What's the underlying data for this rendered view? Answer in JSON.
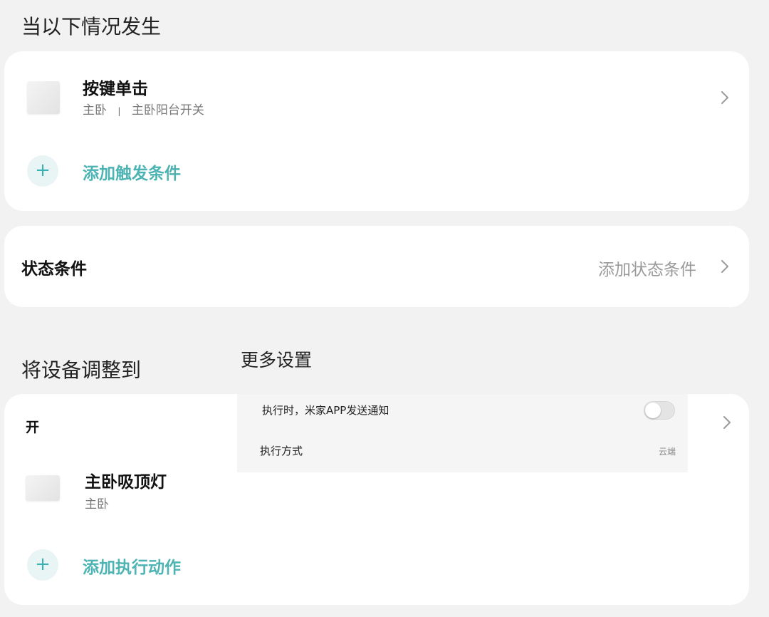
{
  "trigger_section": {
    "title": "当以下情况发生",
    "trigger": {
      "title": "按键单击",
      "room": "主卧",
      "separator": "|",
      "device": "主卧阳台开关",
      "thumb_icon": "switch-device-icon"
    },
    "add_trigger_label": "添加触发条件"
  },
  "state_section": {
    "title": "状态条件",
    "action_label": "添加状态条件"
  },
  "action_section": {
    "title": "将设备调整到",
    "state_label": "开",
    "device": {
      "name": "主卧吸顶灯",
      "room": "主卧",
      "thumb_icon": "ceiling-light-icon"
    },
    "add_action_label": "添加执行动作"
  },
  "more_settings": {
    "title": "更多设置",
    "notify_label": "执行时，米家APP发送通知",
    "notify_enabled": false,
    "exec_mode_label": "执行方式",
    "exec_mode_value": "云端"
  },
  "colors": {
    "accent": "#4db3b3",
    "background": "#f2f2f2",
    "card": "#ffffff"
  }
}
